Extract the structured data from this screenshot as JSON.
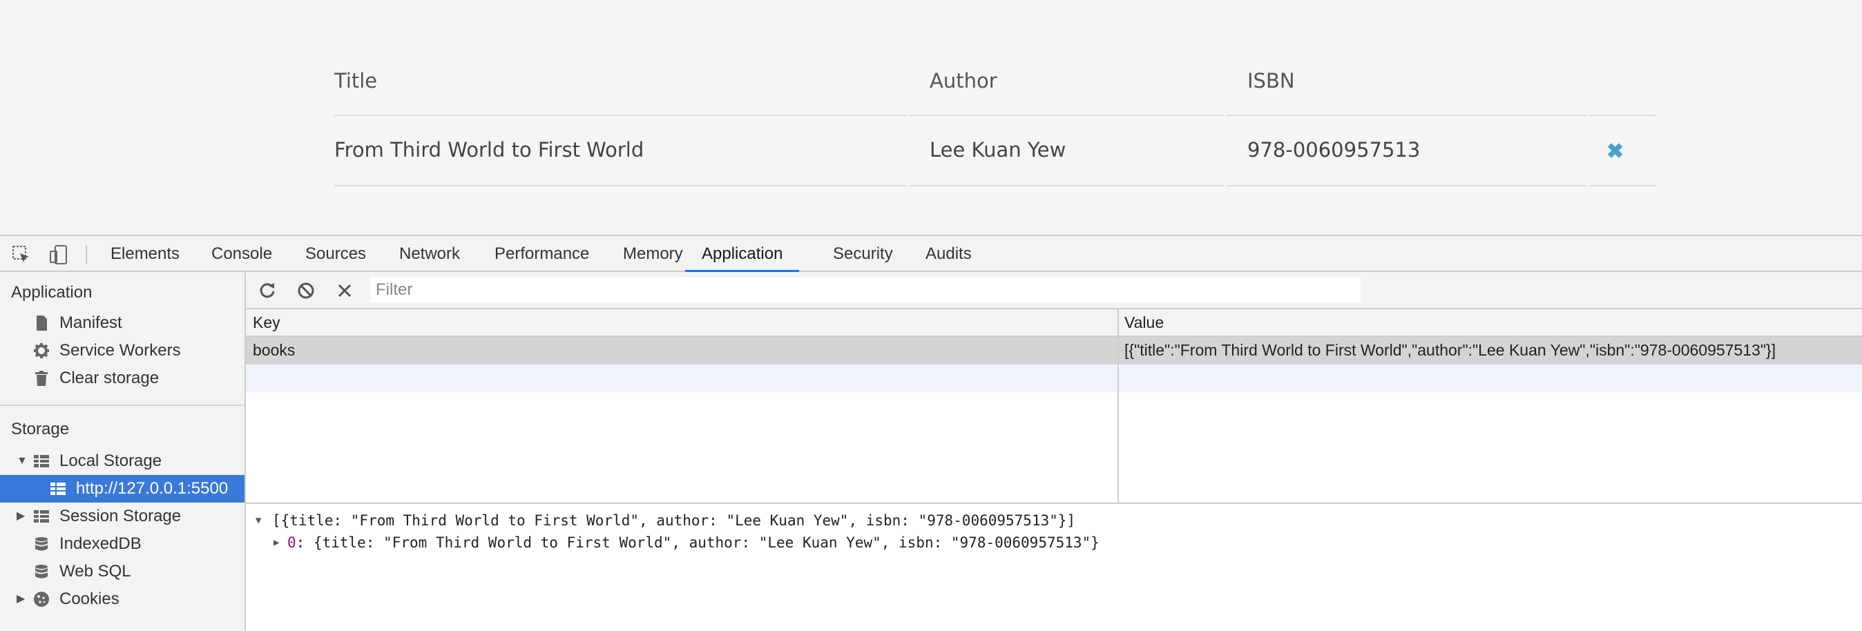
{
  "page": {
    "table": {
      "headers": [
        "Title",
        "Author",
        "ISBN"
      ],
      "rows": [
        {
          "title": "From Third World to First World",
          "author": "Lee Kuan Yew",
          "isbn": "978-0060957513",
          "delete_icon": "close-x-icon",
          "delete_glyph": "✖"
        }
      ]
    },
    "accent_color": "#46a3c7"
  },
  "devtools": {
    "tabs": [
      "Elements",
      "Console",
      "Sources",
      "Network",
      "Performance",
      "Memory",
      "Application",
      "Security",
      "Audits"
    ],
    "active_tab": "Application",
    "sidebar": {
      "application_title": "Application",
      "application_items": [
        {
          "label": "Manifest",
          "icon": "document-icon"
        },
        {
          "label": "Service Workers",
          "icon": "gear-icon"
        },
        {
          "label": "Clear storage",
          "icon": "trash-icon"
        }
      ],
      "storage_title": "Storage",
      "storage_items": [
        {
          "label": "Local Storage",
          "icon": "table-icon",
          "expanded": true
        },
        {
          "label": "http://127.0.0.1:5500",
          "icon": "table-icon",
          "selected": true
        },
        {
          "label": "Session Storage",
          "icon": "table-icon",
          "expanded": false
        },
        {
          "label": "IndexedDB",
          "icon": "database-icon"
        },
        {
          "label": "Web SQL",
          "icon": "database-icon"
        },
        {
          "label": "Cookies",
          "icon": "cookie-icon",
          "expanded": false
        }
      ]
    },
    "toolbar": {
      "filter_placeholder": "Filter",
      "refresh_icon": "refresh-icon",
      "clear_icon": "block-icon",
      "delete_icon": "close-icon"
    },
    "grid": {
      "columns": [
        "Key",
        "Value"
      ],
      "rows": [
        {
          "key": "books",
          "value": "[{\"title\":\"From Third World to First World\",\"author\":\"Lee Kuan Yew\",\"isbn\":\"978-0060957513\"}]"
        }
      ]
    },
    "preview": {
      "root": "[{title: \"From Third World to First World\", author: \"Lee Kuan Yew\", isbn: \"978-0060957513\"}]",
      "item_key": "0",
      "item_value": ": {title: \"From Third World to First World\", author: \"Lee Kuan Yew\", isbn: \"978-0060957513\"}"
    },
    "selection_color": "#3879d9",
    "active_tab_color": "#1a73e8"
  }
}
